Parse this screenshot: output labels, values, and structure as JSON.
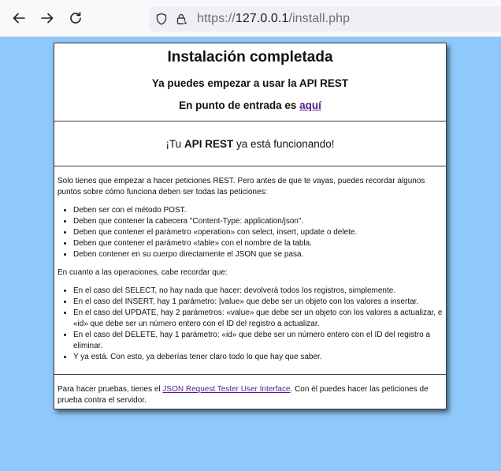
{
  "browser": {
    "url_proto": "https://",
    "url_host": "127.0.0.1",
    "url_path": "/install.php"
  },
  "header": {
    "title": "Instalación completada",
    "subtitle": "Ya puedes empezar a usar la API REST",
    "entry_prefix": "En punto de entrada es ",
    "entry_link": "aquí"
  },
  "status": {
    "prefix": "¡Tu ",
    "strong": "API REST",
    "suffix": " ya está funcionando!"
  },
  "info": {
    "intro": "Solo tienes que empezar a hacer peticiones REST. Pero antes de que te vayas, puedes recordar algunos puntos sobre cómo funciona deben ser todas las peticiones:",
    "rules": [
      "Deben ser con el método POST.",
      "Deben que contener la cabecera \"Content-Type: application/json\".",
      "Deben que contener el parámetro «operation» con select, insert, update o delete.",
      "Deben que contener el parámetro «table» con el nombre de la tabla.",
      "Deben contener en su cuerpo directamente el JSON que se pasa."
    ],
    "ops_intro": "En cuanto a las operaciones, cabe recordar que:",
    "ops": [
      "En el caso del SELECT, no hay nada que hacer: devolverá todos los registros, simplemente.",
      "En el caso del INSERT, hay 1 parámetro: |value» que debe ser un objeto con los valores a insertar.",
      "En el caso del UPDATE, hay 2 parámetros: «value» que debe ser un objeto con los valores a actualizar, e «id» que debe ser un número entero con el ID del registro a actualizar.",
      "En el caso del DELETE, hay 1 parámetro: «id» que debe ser un número entero con el ID del registro a eliminar.",
      "Y ya está. Con esto, ya deberías tener claro todo lo que hay que saber."
    ]
  },
  "footer": {
    "prefix": "Para hacer pruebas, tienes el ",
    "link": "JSON Request Tester User Interface",
    "suffix": ". Con él puedes hacer las peticiones de prueba contra el servidor."
  }
}
